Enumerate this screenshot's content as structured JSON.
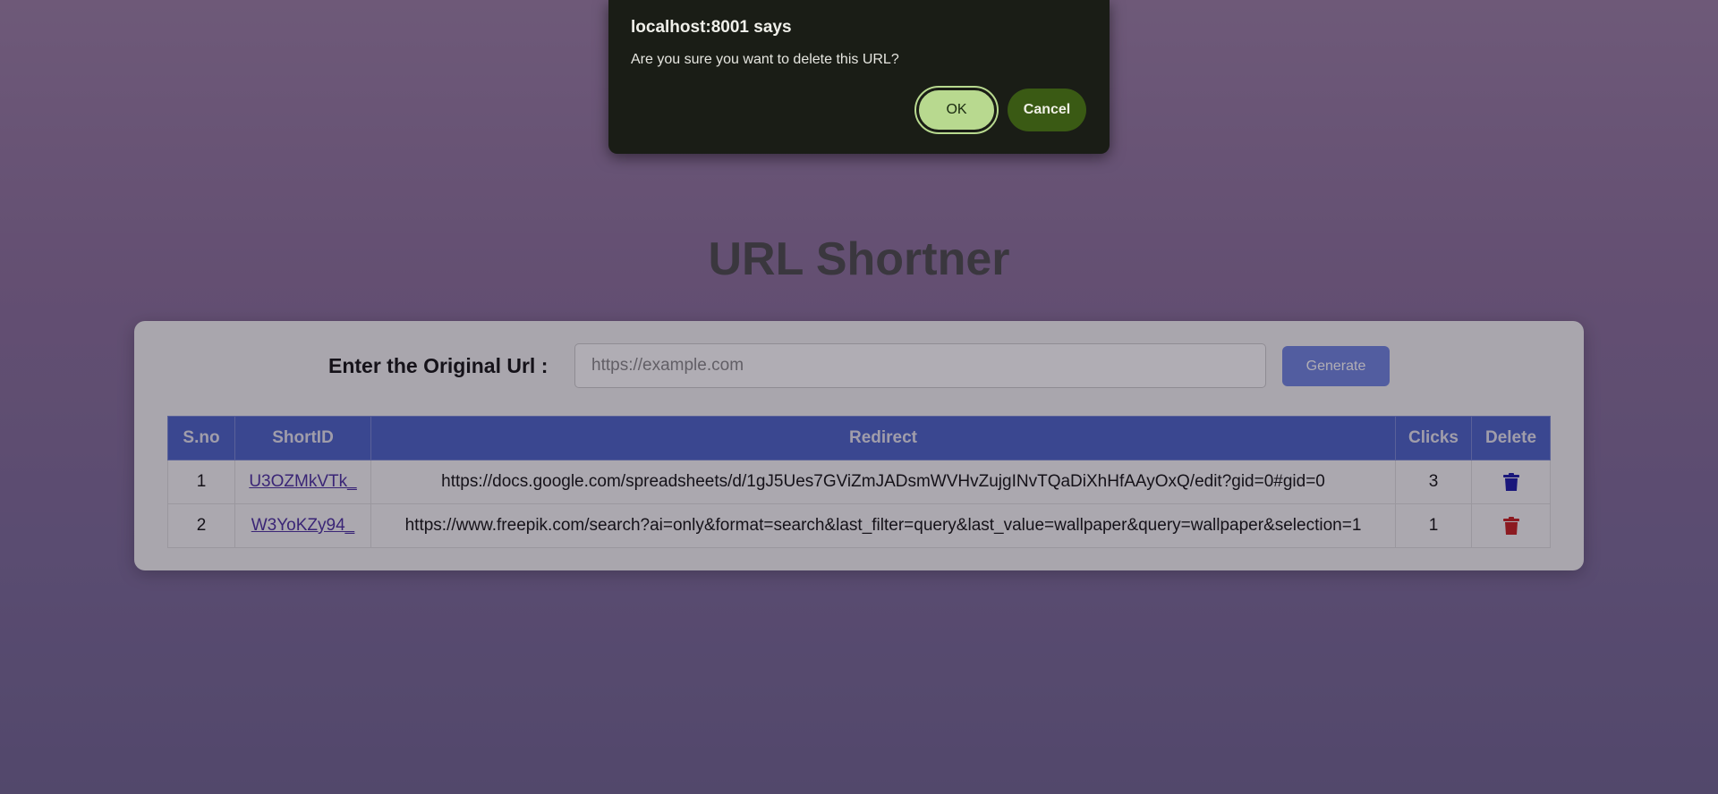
{
  "page": {
    "title": "URL Shortner",
    "form_label": "Enter the Original Url :",
    "input_placeholder": "https://example.com",
    "generate_label": "Generate"
  },
  "table": {
    "headers": [
      "S.no",
      "ShortID",
      "Redirect",
      "Clicks",
      "Delete"
    ],
    "rows": [
      {
        "sno": "1",
        "short_id": "U3OZMkVTk_",
        "redirect": "https://docs.google.com/spreadsheets/d/1gJ5Ues7GViZmJADsmWVHvZujgINvTQaDiXhHfAAyOxQ/edit?gid=0#gid=0",
        "clicks": "3",
        "delete_icon": "trash-icon",
        "delete_color": "#1a1aa8"
      },
      {
        "sno": "2",
        "short_id": "W3YoKZy94_",
        "redirect": "https://www.freepik.com/search?ai=only&format=search&last_filter=query&last_value=wallpaper&query=wallpaper&selection=1",
        "clicks": "1",
        "delete_icon": "trash-icon",
        "delete_color": "#c81e1e"
      }
    ]
  },
  "dialog": {
    "title": "localhost:8001 says",
    "message": "Are you sure you want to delete this URL?",
    "ok_label": "OK",
    "cancel_label": "Cancel"
  }
}
